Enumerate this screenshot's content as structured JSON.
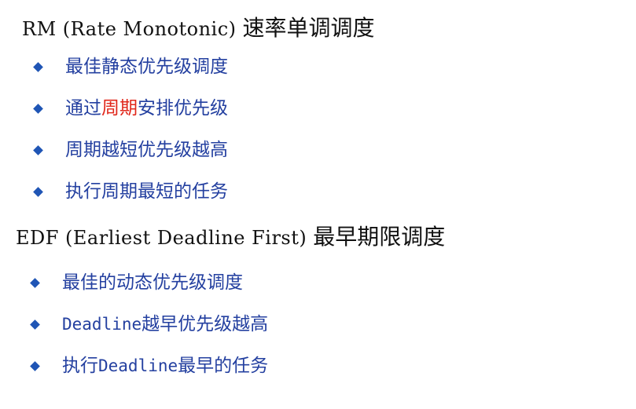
{
  "rm": {
    "title_latin": "RM (Rate Monotonic)",
    "title_cjk": "速率单调调度",
    "items": [
      "最佳静态优先级调度",
      {
        "pre": "通过",
        "highlight": "周期",
        "post": "安排优先级"
      },
      "周期越短优先级越高",
      "执行周期最短的任务"
    ]
  },
  "edf": {
    "title_latin": "EDF (Earliest Deadline First)",
    "title_cjk": "最早期限调度",
    "items": [
      "最佳的动态优先级调度",
      {
        "latin": "Deadline",
        "rest": "越早优先级越高"
      },
      {
        "pre": "执行",
        "latin": "Deadline",
        "rest": "最早的任务"
      }
    ]
  },
  "colors": {
    "heading": "#111111",
    "bullet": "#1f55b5",
    "item_text": "#2440a0",
    "highlight": "#e0261a"
  },
  "icons": {
    "bullet": "diamond-bullet-icon"
  }
}
